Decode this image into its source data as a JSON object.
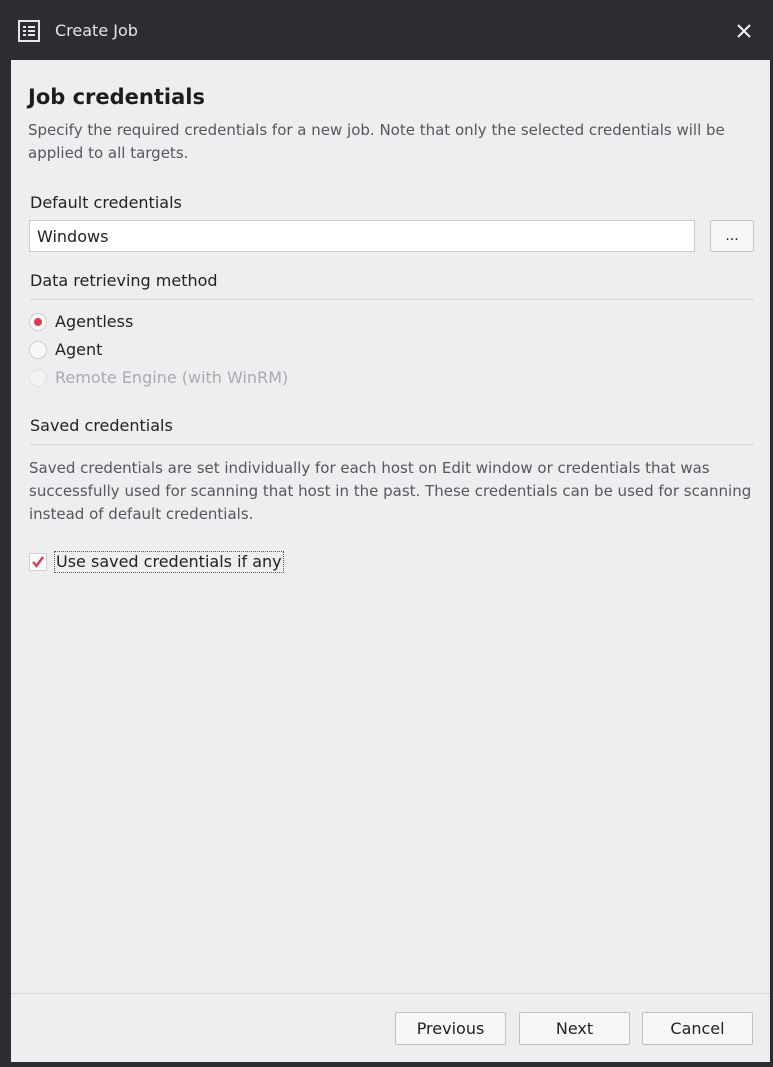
{
  "window": {
    "title": "Create Job",
    "title_icon": "list-window-icon",
    "close_icon": "close-icon"
  },
  "page": {
    "title": "Job credentials",
    "description": "Specify the required credentials for a new job. Note that only the selected credentials will be applied to all targets."
  },
  "default_credentials": {
    "label": "Default credentials",
    "value": "Windows",
    "browse_label": "..."
  },
  "data_method": {
    "header": "Data retrieving method",
    "options": [
      {
        "label": "Agentless",
        "selected": true,
        "disabled": false
      },
      {
        "label": "Agent",
        "selected": false,
        "disabled": false
      },
      {
        "label": "Remote Engine (with WinRM)",
        "selected": false,
        "disabled": true
      }
    ]
  },
  "saved_credentials": {
    "header": "Saved credentials",
    "description": "Saved credentials are set individually for each host on Edit window or credentials that was successfully used for scanning that host in the past. These credentials can be used for scanning instead of default credentials.",
    "checkbox_label": "Use saved credentials if any",
    "checked": true
  },
  "footer": {
    "previous_label": "Previous",
    "next_label": "Next",
    "cancel_label": "Cancel"
  },
  "colors": {
    "accent": "#e0394f",
    "titlebar": "#2b2d31",
    "panel": "#eeeef1"
  }
}
